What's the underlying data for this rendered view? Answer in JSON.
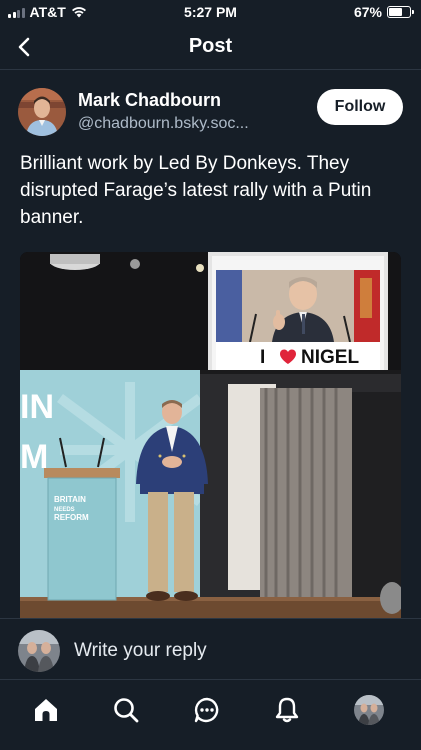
{
  "status_bar": {
    "carrier": "AT&T",
    "time": "5:27 PM",
    "battery_percent_label": "67%",
    "battery_level": 0.67
  },
  "header": {
    "title": "Post",
    "back_icon": "chevron-left-icon"
  },
  "post": {
    "author_name": "Mark Chadbourn",
    "author_handle": "@chadbourn.bsky.soc...",
    "follow_label": "Follow",
    "text": "Brilliant work by Led By Donkeys. They disrupted Farage’s latest rally with a Putin banner.",
    "image": {
      "banner_text": "I ♥ NIGEL",
      "banner_text_before": "I",
      "banner_text_after": "NIGEL",
      "lectern_text_lines": [
        "BRITAIN",
        "NEEDS",
        "REFORM"
      ],
      "backdrop_letters_top": "IN",
      "backdrop_letters_bottom": "M"
    }
  },
  "reply": {
    "placeholder": "Write your reply"
  },
  "tab_bar": {
    "items": [
      "home-icon",
      "search-icon",
      "chat-icon",
      "bell-icon",
      "profile-avatar"
    ]
  },
  "colors": {
    "background": "#161e27",
    "divider": "#2c3642",
    "secondary_text": "#aebbc9",
    "accent_heart": "#e0243a"
  }
}
